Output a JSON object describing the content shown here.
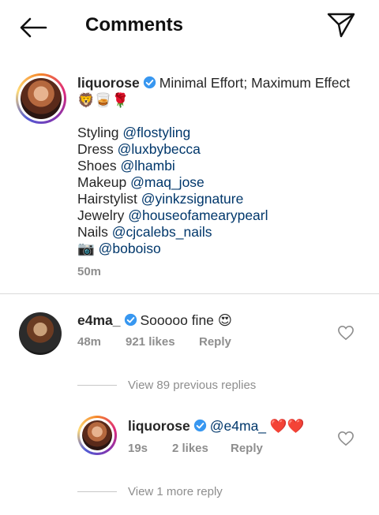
{
  "header": {
    "title": "Comments",
    "back_icon": "arrow-left-icon",
    "send_icon": "paper-plane-icon"
  },
  "caption": {
    "username": "liquorose",
    "text": "Minimal Effort; Maximum Effect",
    "emojis": "🦁🥃🌹",
    "credits": [
      {
        "label": "Styling",
        "mention": "@flostyling"
      },
      {
        "label": "Dress",
        "mention": "@luxbybecca"
      },
      {
        "label": "Shoes",
        "mention": "@lhambi"
      },
      {
        "label": "Makeup",
        "mention": "@maq_jose"
      },
      {
        "label": "Hairstylist",
        "mention": "@yinkzsignature"
      },
      {
        "label": "Jewelry",
        "mention": "@houseofamearypearl"
      },
      {
        "label": "Nails",
        "mention": "@cjcalebs_nails"
      },
      {
        "label": "📷",
        "mention": "@boboiso"
      }
    ],
    "time": "50m"
  },
  "comment": {
    "username": "e4ma_",
    "text": "Sooooo fine",
    "emoji": "😍",
    "time": "48m",
    "likes": "921 likes",
    "reply": "Reply",
    "view_replies": "View 89 previous replies"
  },
  "reply": {
    "username": "liquorose",
    "mention": "@e4ma_",
    "emoji": "❤️❤️",
    "time": "19s",
    "likes": "2 likes",
    "reply": "Reply",
    "view_more": "View 1 more reply"
  },
  "colors": {
    "mention": "#00376b",
    "verified": "#3897f0",
    "meta": "#8e8e8e",
    "emoji_heart": "#d0021b"
  }
}
